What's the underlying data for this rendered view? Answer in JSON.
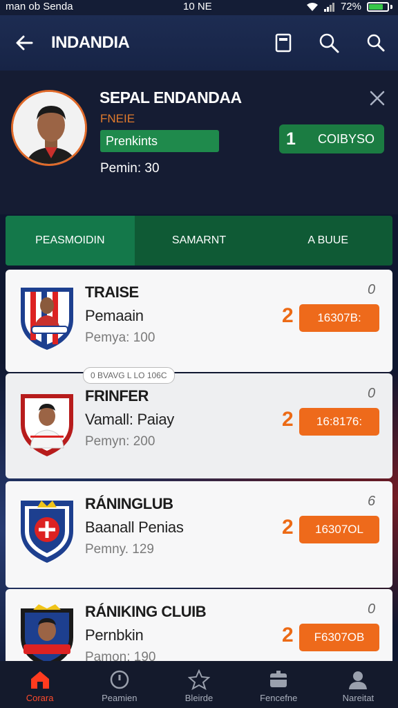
{
  "status_bar": {
    "carrier": "man ob Senda",
    "time": "10 NE",
    "battery": "72%",
    "battery_level": 0.72
  },
  "header": {
    "title": "INDANDIA"
  },
  "profile": {
    "name": "SEPAL ENDANDAA",
    "subtitle": "FNEIE",
    "rank_pill": "Prenkints",
    "meta": "Pemin: 30",
    "score_number": "1",
    "score_label": "COIBYSO"
  },
  "tabs": [
    {
      "label": "PEASMOIDIN",
      "active": true
    },
    {
      "label": "SAMARNT",
      "active": false
    },
    {
      "label": "A BUUE",
      "active": false
    }
  ],
  "cards": [
    {
      "title": "TRAISE",
      "subtitle": "Pemaain",
      "meta": "Pemya: 100",
      "rank": "2",
      "button": "16307B:",
      "corner": "0"
    },
    {
      "title": "FRINFER",
      "subtitle": "Vamall: Paiay",
      "meta": "Pemyn: 200",
      "rank": "2",
      "button": "16:8176:",
      "corner": "0"
    },
    {
      "title": "RÁNINGLUB",
      "subtitle": "Baanall Penias",
      "meta": "Pemny. 129",
      "rank": "2",
      "button": "16307OL",
      "corner": "6"
    },
    {
      "title": "RÁNIKING CLUIB",
      "subtitle": "Pernbkin",
      "meta": "Pamon: 190",
      "rank": "2",
      "button": "F6307OB",
      "corner": "0"
    }
  ],
  "card_tag": "0 BVAVG L LO 106C",
  "bottom_nav": [
    {
      "label": "Corara",
      "icon": "home-icon",
      "active": true
    },
    {
      "label": "Peamien",
      "icon": "clock-icon",
      "active": false
    },
    {
      "label": "Bleirde",
      "icon": "star-icon",
      "active": false
    },
    {
      "label": "Fencefne",
      "icon": "briefcase-icon",
      "active": false
    },
    {
      "label": "Nareitat",
      "icon": "person-icon",
      "active": false
    }
  ],
  "colors": {
    "accent_orange": "#ee6a1b",
    "accent_green": "#1f8a4c",
    "nav_active": "#ff4b2b",
    "header_bg": "#1d2c52"
  }
}
